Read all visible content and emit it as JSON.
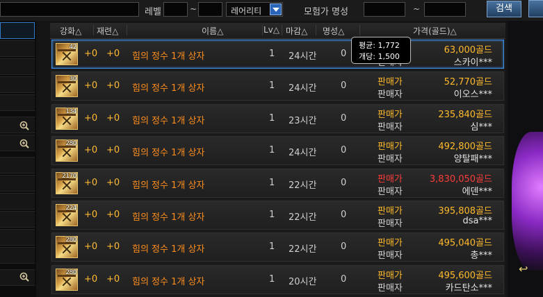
{
  "filters": {
    "level_label": "레벨",
    "range_sep": "~",
    "rarity_value": "레어리티",
    "fame_label": "모험가 명성",
    "search_label": "검색"
  },
  "table": {
    "headers": [
      "강화△",
      "재련△",
      "이름△",
      "Lv△",
      "마감△",
      "명성△",
      "가격(골드)△"
    ]
  },
  "tooltip": {
    "avg": "평균: 1,772",
    "unit": "개당: 1,500"
  },
  "rows": [
    {
      "count": "42",
      "enh": "+0",
      "ref": "+0",
      "name": "힘의 정수 1개 상자",
      "lv": "1",
      "deadline": "24시간",
      "fame": "0",
      "label1": "판매가",
      "label2": "판매자",
      "price": "63,000골드",
      "seller": "스카이***"
    },
    {
      "count": "30",
      "enh": "+0",
      "ref": "+0",
      "name": "힘의 정수 1개 상자",
      "lv": "1",
      "deadline": "24시간",
      "fame": "0",
      "label1": "판매가",
      "label2": "판매자",
      "price": "52,770골드",
      "seller": "이오스***"
    },
    {
      "count": "134",
      "enh": "+0",
      "ref": "+0",
      "name": "힘의 정수 1개 상자",
      "lv": "1",
      "deadline": "23시간",
      "fame": "0",
      "label1": "판매가",
      "label2": "판매자",
      "price": "235,840골드",
      "seller": "심***"
    },
    {
      "count": "280",
      "enh": "+0",
      "ref": "+0",
      "name": "힘의 정수 1개 상자",
      "lv": "1",
      "deadline": "24시간",
      "fame": "0",
      "label1": "판매가",
      "label2": "판매자",
      "price": "492,800골드",
      "seller": "양탈패***"
    },
    {
      "count": "2170",
      "enh": "+0",
      "ref": "+0",
      "name": "힘의 정수 1개 상자",
      "lv": "1",
      "deadline": "22시간",
      "fame": "0",
      "label1": "판매가",
      "label2": "판매자",
      "price": "3,830,050골드",
      "seller": "에덴***"
    },
    {
      "count": "224",
      "enh": "+0",
      "ref": "+0",
      "name": "힘의 정수 1개 상자",
      "lv": "1",
      "deadline": "22시간",
      "fame": "0",
      "label1": "판매가",
      "label2": "판매자",
      "price": "395,808골드",
      "seller": "dsa***"
    },
    {
      "count": "280",
      "enh": "+0",
      "ref": "+0",
      "name": "힘의 정수 1개 상자",
      "lv": "1",
      "deadline": "22시간",
      "fame": "0",
      "label1": "판매가",
      "label2": "판매자",
      "price": "495,040골드",
      "seller": "총***"
    },
    {
      "count": "280",
      "enh": "+0",
      "ref": "+0",
      "name": "힘의 정수 1개 상자",
      "lv": "1",
      "deadline": "20시간",
      "fame": "0",
      "label1": "판매가",
      "label2": "판매자",
      "price": "495,600골드",
      "seller": "카드탄소***"
    }
  ],
  "colors": {
    "price": "#ffba2a",
    "price_high": "#ff3b3b",
    "item_name": "#ff8e1d",
    "selection": "#3b8be0"
  }
}
